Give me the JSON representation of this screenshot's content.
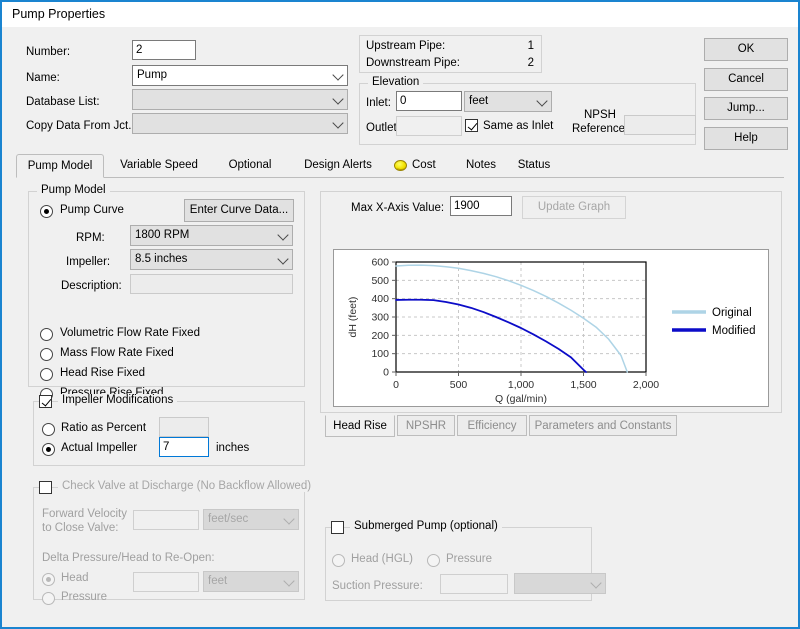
{
  "window": {
    "title": "Pump Properties"
  },
  "header": {
    "number_label": "Number:",
    "number_value": "2",
    "name_label": "Name:",
    "name_value": "Pump",
    "database_label": "Database List:",
    "database_value": "",
    "copy_label": "Copy Data From Jct...",
    "copy_value": "",
    "upstream_label": "Upstream Pipe:",
    "upstream_value": "1",
    "downstream_label": "Downstream Pipe:",
    "downstream_value": "2",
    "elevation_group": "Elevation",
    "inlet_label": "Inlet:",
    "inlet_value": "0",
    "inlet_units": "feet",
    "outlet_label": "Outlet:",
    "outlet_value": "",
    "same_as_inlet": "Same as Inlet",
    "npsh_label_1": "NPSH",
    "npsh_label_2": "Reference:",
    "npsh_value": ""
  },
  "buttons": {
    "ok": "OK",
    "cancel": "Cancel",
    "jump": "Jump...",
    "help": "Help"
  },
  "tabs": [
    {
      "label": "Pump Model",
      "active": true,
      "icon": ""
    },
    {
      "label": "Variable Speed",
      "active": false,
      "icon": ""
    },
    {
      "label": "Optional",
      "active": false,
      "icon": ""
    },
    {
      "label": "Design Alerts",
      "active": false,
      "icon": ""
    },
    {
      "label": "Cost",
      "active": false,
      "icon": "coin-icon"
    },
    {
      "label": "Notes",
      "active": false,
      "icon": ""
    },
    {
      "label": "Status",
      "active": false,
      "icon": ""
    }
  ],
  "pump_model": {
    "group_title": "Pump Model",
    "enter_curve_data": "Enter Curve Data...",
    "options": [
      {
        "label": "Pump Curve",
        "checked": true
      },
      {
        "label": "Volumetric Flow Rate Fixed",
        "checked": false
      },
      {
        "label": "Mass Flow Rate Fixed",
        "checked": false
      },
      {
        "label": "Head Rise Fixed",
        "checked": false
      },
      {
        "label": "Pressure Rise Fixed",
        "checked": false
      }
    ],
    "rpm_label": "RPM:",
    "rpm_value": "1800 RPM",
    "impeller_label": "Impeller:",
    "impeller_value": "8.5 inches",
    "description_label": "Description:",
    "description_value": ""
  },
  "impeller_mods": {
    "group_title": "Impeller Modifications",
    "checked": true,
    "ratio_label": "Ratio as Percent",
    "ratio_checked": false,
    "ratio_value": "",
    "actual_label": "Actual Impeller",
    "actual_checked": true,
    "actual_value": "7",
    "actual_units": "inches"
  },
  "check_valve": {
    "group_title": "Check Valve at Discharge (No Backflow Allowed)",
    "checked": false,
    "fwd_vel_line1": "Forward Velocity",
    "fwd_vel_line2": "to Close Valve:",
    "fwd_vel_value": "",
    "fwd_vel_units": "feet/sec",
    "delta_label": "Delta Pressure/Head to Re-Open:",
    "head_label": "Head",
    "head_checked": true,
    "pressure_label": "Pressure",
    "pressure_checked": false,
    "delta_value": "",
    "delta_units": "feet"
  },
  "submerged": {
    "group_title": "Submerged Pump (optional)",
    "checked": false,
    "head_hgl_label": "Head (HGL)",
    "head_hgl_checked": false,
    "pressure_label": "Pressure",
    "pressure_checked": false,
    "suction_label": "Suction Pressure:",
    "suction_value": "",
    "suction_units": ""
  },
  "graph": {
    "max_x_label": "Max X-Axis Value:",
    "max_x_value": "1900",
    "update_button": "Update Graph",
    "bottom_tabs": [
      {
        "label": "Head Rise",
        "active": true
      },
      {
        "label": "NPSHR",
        "active": false
      },
      {
        "label": "Efficiency",
        "active": false
      },
      {
        "label": "Parameters and Constants",
        "active": false
      }
    ]
  },
  "chart_data": {
    "type": "line",
    "title": "",
    "xlabel": "Q (gal/min)",
    "ylabel": "dH (feet)",
    "xlim": [
      0,
      2000
    ],
    "ylim": [
      0,
      600
    ],
    "xticks": [
      0,
      500,
      1000,
      1500,
      2000
    ],
    "xticklabels": [
      "0",
      "500",
      "1,000",
      "1,500",
      "2,000"
    ],
    "yticks": [
      0,
      100,
      200,
      300,
      400,
      500,
      600
    ],
    "yticklabels": [
      "0",
      "100",
      "200",
      "300",
      "400",
      "500",
      "600"
    ],
    "grid": true,
    "legend_position": "right",
    "series": [
      {
        "name": "Original",
        "color": "#aed4e6",
        "x": [
          0,
          100,
          200,
          300,
          400,
          500,
          600,
          700,
          800,
          900,
          1000,
          1100,
          1200,
          1300,
          1400,
          1500,
          1600,
          1700,
          1800,
          1850
        ],
        "y": [
          578,
          582,
          583,
          580,
          574,
          566,
          553,
          538,
          520,
          498,
          473,
          444,
          412,
          376,
          337,
          293,
          245,
          180,
          90,
          0
        ]
      },
      {
        "name": "Modified",
        "color": "#0c0cc8",
        "x": [
          0,
          100,
          200,
          300,
          400,
          500,
          600,
          700,
          800,
          900,
          1000,
          1100,
          1200,
          1300,
          1400,
          1500,
          1520
        ],
        "y": [
          393,
          394,
          394,
          392,
          382,
          368,
          350,
          327,
          300,
          271,
          240,
          205,
          167,
          126,
          80,
          12,
          0
        ]
      }
    ]
  }
}
